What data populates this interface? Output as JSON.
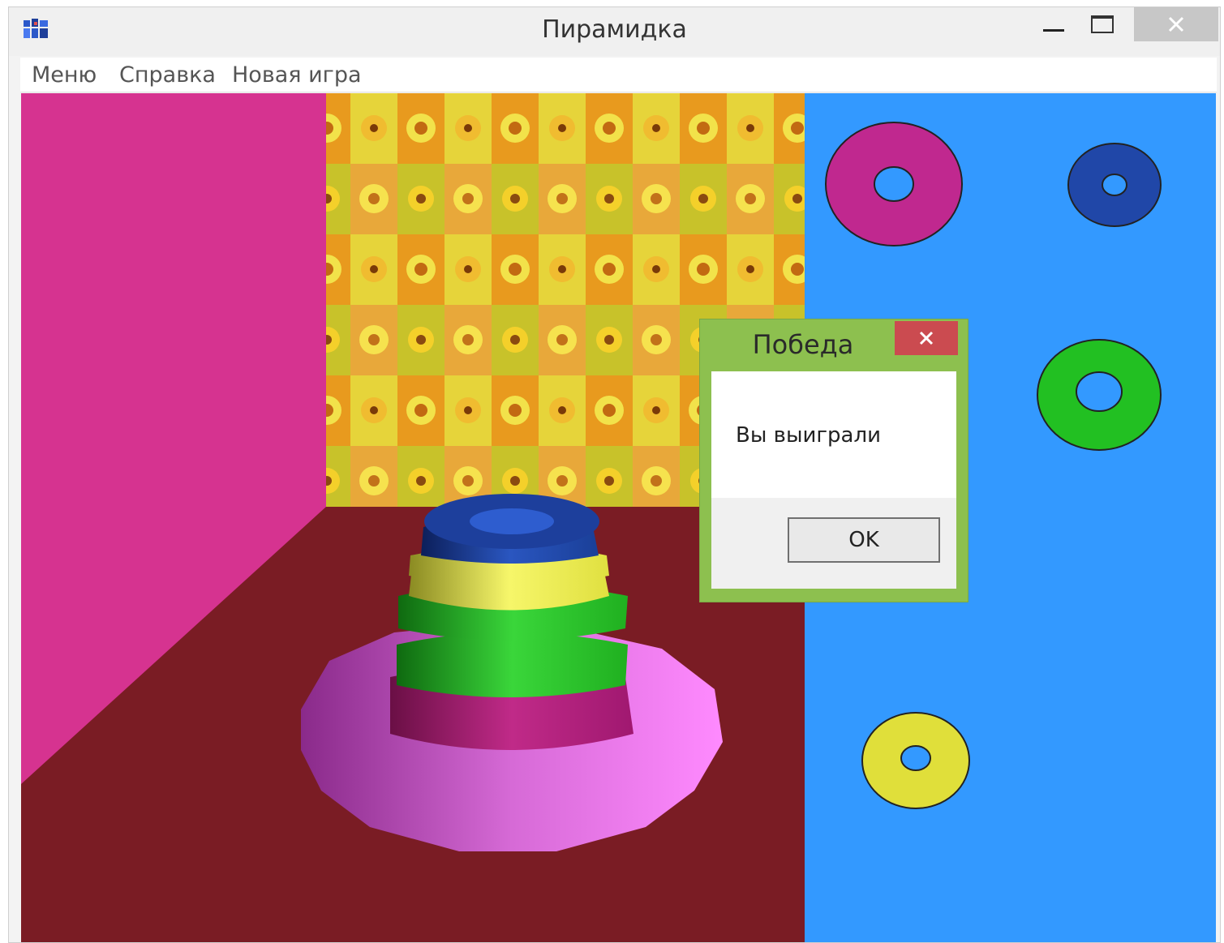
{
  "window": {
    "title": "Пирамидка",
    "app_icon": "app-grid-icon"
  },
  "titlebar_buttons": {
    "minimize": "minimize-icon",
    "maximize": "maximize-icon",
    "close": "close-icon"
  },
  "menu": {
    "items": [
      "Меню",
      "Справка",
      "Новая игра"
    ]
  },
  "scene": {
    "left_wall_color": "#d63390",
    "floor_color": "#7a1c24",
    "right_panel_color": "#3399ff",
    "pyramid_rings": [
      {
        "color": "#e680e6",
        "name": "pink-base"
      },
      {
        "color": "#b01f7a",
        "name": "magenta"
      },
      {
        "color": "#33cc22",
        "name": "green"
      },
      {
        "color": "#e6e64d",
        "name": "yellow"
      },
      {
        "color": "#1f4bab",
        "name": "blue"
      }
    ],
    "loose_rings": [
      {
        "color": "#c0288f",
        "name": "magenta"
      },
      {
        "color": "#2047a8",
        "name": "blue"
      },
      {
        "color": "#22c022",
        "name": "green"
      },
      {
        "color": "#e0df3a",
        "name": "yellow"
      }
    ]
  },
  "dialog": {
    "title": "Победа",
    "message": "Вы выиграли",
    "ok_label": "OK",
    "close_icon": "close-icon"
  }
}
